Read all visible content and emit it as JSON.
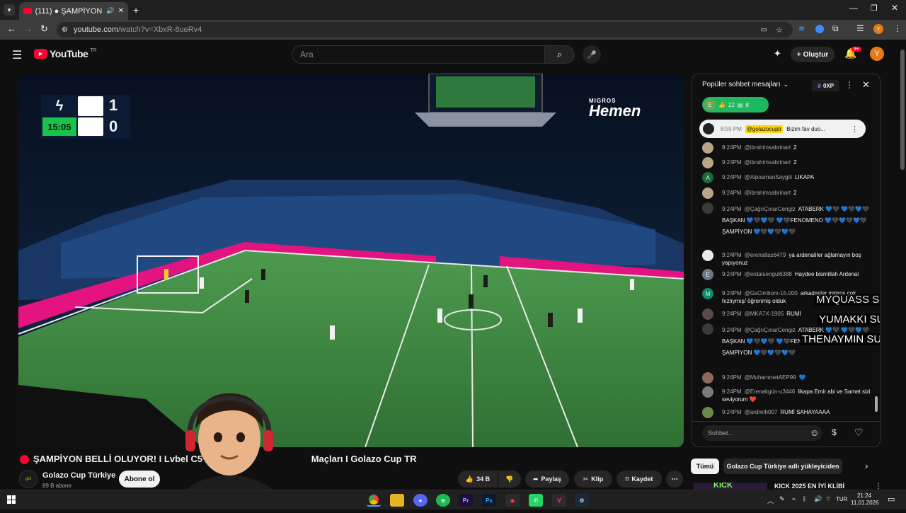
{
  "browser": {
    "tab_title": "(111) ● ŞAMPİYON BELLİ O",
    "url_domain": "youtube.com",
    "url_path": "/watch?v=XbxR-8ueRv4"
  },
  "youtube": {
    "logo_text": "YouTube",
    "logo_region": "TR",
    "search_placeholder": "Ara",
    "create_label": "Oluştur",
    "notif_badge": "9+",
    "avatar_letter": "Y"
  },
  "scoreboard": {
    "home_score": "1",
    "away_score": "0",
    "clock": "15:05",
    "brand_line1": "MIGROS",
    "brand_line2": "Hemen"
  },
  "video": {
    "title": "ŞAMPİYON BELLİ OLUYOR! I Lvbel C5",
    "title_tail": "Maçları I Golazo Cup TR",
    "channel": "Golazo Cup Türkiye",
    "subscribers": "89 B abone",
    "subscribe_label": "Abone ol",
    "like_count": "34 B",
    "share_label": "Paylaş",
    "clip_label": "Klip",
    "save_label": "Kaydet"
  },
  "chat": {
    "header_title": "Popüler sohbet mesajları",
    "xp_label": "0XP",
    "poll_initial": "E",
    "poll_likes": "22",
    "poll_msgs": "8",
    "pinned_time": "8:55 PM",
    "pinned_author": "@golazocuptr",
    "pinned_text": "Bizim fav duo...",
    "input_placeholder": "Sohbet...",
    "messages": [
      {
        "time": "9:24PM",
        "author": "@ibrahimsabrinart",
        "text": "2"
      },
      {
        "time": "9:24PM",
        "author": "@ibrahimsabrinart",
        "text": "2"
      },
      {
        "time": "9:24PM",
        "author": "@AlposmanSaygili",
        "text": "LIKAPA",
        "initial": "A"
      },
      {
        "time": "9:24PM",
        "author": "@ibrahimsabrinart",
        "text": "2"
      },
      {
        "time": "9:24PM",
        "author": "@ÇağrıÇınarCengiz",
        "text": "ATABERK 💙🖤 💙🖤💙🖤BAŞKAN 💙🖤💙🖤 💙🖤FENOMENO 💙🖤💙🖤💙🖤 ŞAMPİYON 💙🖤💙🖤💙🖤"
      },
      {
        "time": "9:24PM",
        "author": "@erenaltas6479",
        "text": "ya ardenaliler ağlamayın boş yapıyonuz"
      },
      {
        "time": "9:24PM",
        "author": "@erdalsengul6388",
        "text": "Haydee bismillah Ardenal",
        "initial": "E"
      },
      {
        "time": "9:24PM",
        "author": "@GsCimbom-15.000",
        "text": "arkadaşlar migros çok hızlıymış/ öğrenmiş olduk",
        "initial": "M"
      },
      {
        "time": "9:24PM",
        "author": "@MKA7X-1905",
        "text": "RUMİ"
      },
      {
        "time": "9:24PM",
        "author": "@ÇağrıÇınarCengiz",
        "text": "ATABERK 💙🖤 💙🖤💙🖤BAŞKAN 💙🖤💙🖤 💙🖤FENOMENO 💙🖤💙🖤💙🖤 ŞAMPİYON 💙🖤💙🖤💙🖤"
      },
      {
        "time": "9:24PM",
        "author": "@MuhammetAEP99",
        "text": "💙"
      },
      {
        "time": "9:24PM",
        "author": "@Erenakgün-u3446",
        "text": "likapa Emir abi ve Samet sizi seviyorum ❤️"
      },
      {
        "time": "9:24PM",
        "author": "@ardreth007",
        "text": "RUMİ SAHAYAAAA"
      }
    ],
    "overlay_subs": [
      "MYQUASS  SUB",
      "YUMAKKI  SUB",
      "THENAYMIN  SUB"
    ]
  },
  "recommendations": {
    "chip_all": "Tümü",
    "chip_uploader": "Golazo Cup Türkiye adlı yükleyiciden",
    "first_video_title": "KICK 2025 EN İYİ KLİBİ",
    "thumb_text": "KICK"
  },
  "taskbar": {
    "time": "21:24",
    "date": "11.01.2026",
    "lang": "TUR"
  },
  "colors": {
    "yt_red": "#ff0033",
    "pitch": "#3f8a44",
    "led_pink": "#e3147f",
    "score_green": "#19c24a"
  }
}
